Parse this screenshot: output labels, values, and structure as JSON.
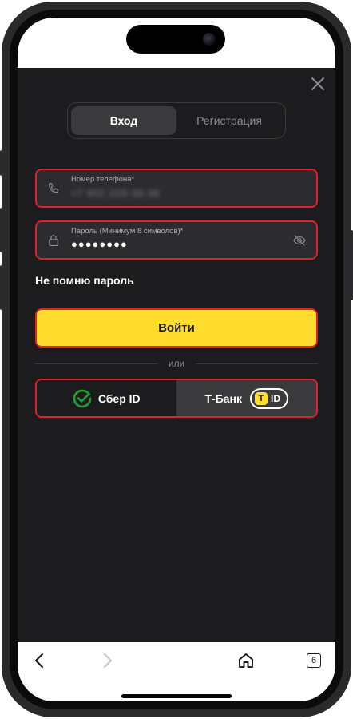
{
  "colors": {
    "background_dark": "#1c1c1e",
    "field_bg": "#2c2c2e",
    "highlight_border": "#e0222a",
    "accent_yellow": "#ffdd2d",
    "sber_green": "#21a038"
  },
  "tabs": [
    {
      "label": "Вход",
      "active": true
    },
    {
      "label": "Регистрация",
      "active": false
    }
  ],
  "phone_field": {
    "label": "Номер телефона*",
    "value": "+7 902 229-38-38",
    "icon": "phone-icon"
  },
  "password_field": {
    "label": "Пароль (Минимум 8 символов)*",
    "value": "●●●●●●●●",
    "icon": "lock-icon",
    "toggle_icon": "eye-off-icon"
  },
  "forgot_password": "Не помню пароль",
  "login_button": "Войти",
  "divider_text": "или",
  "alt_login": {
    "sber_label": "Сбер ID",
    "tbank_label": "Т-Банк",
    "tid_badge_letter": "T",
    "tid_badge_text": "ID"
  },
  "browser": {
    "tabs_count": "6",
    "back_icon": "chevron-left-icon",
    "forward_icon": "chevron-right-icon",
    "home_icon": "home-icon"
  }
}
